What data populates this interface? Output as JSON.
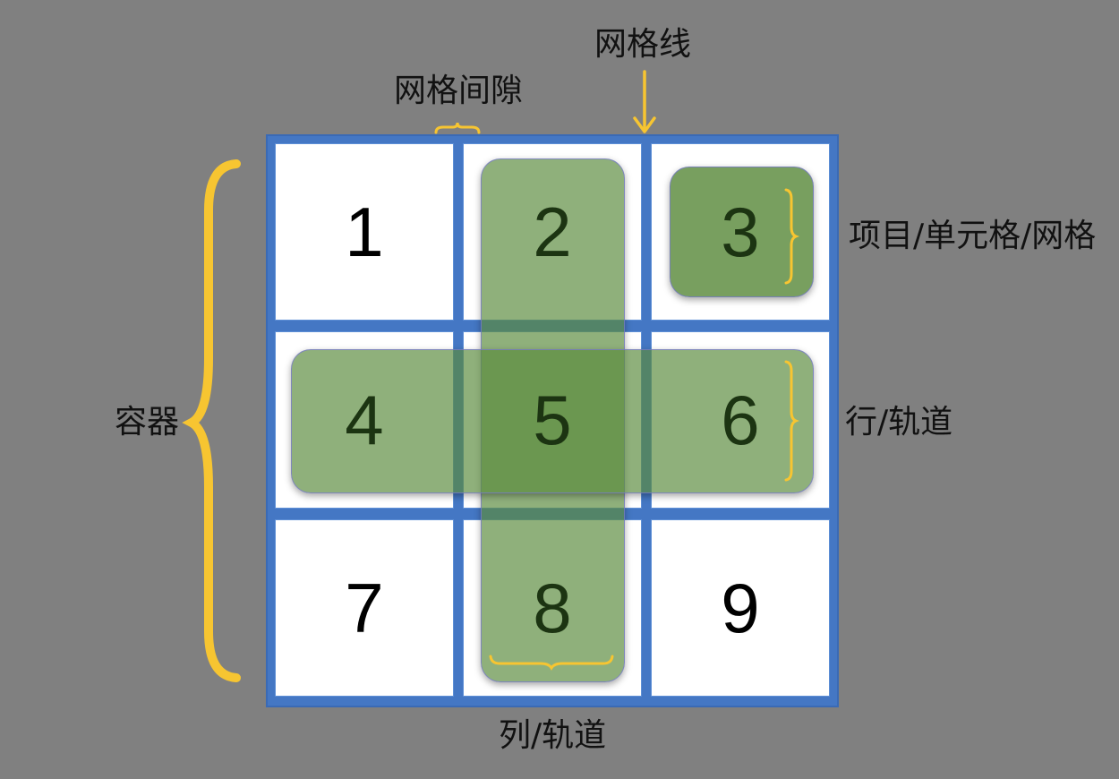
{
  "labels": {
    "grid_line": "网格线",
    "grid_gap": "网格间隙",
    "item_cell": "项目/单元格/网格",
    "row_track": "行/轨道",
    "container": "容器",
    "column_track": "列/轨道"
  },
  "cells": [
    "1",
    "2",
    "3",
    "4",
    "5",
    "6",
    "7",
    "8",
    "9"
  ],
  "colors": {
    "background": "#808080",
    "container_border": "#4477c4",
    "cell_fill": "#ffffff",
    "highlight_green": "#5a8a3c",
    "brace_yellow": "#f7c531"
  }
}
